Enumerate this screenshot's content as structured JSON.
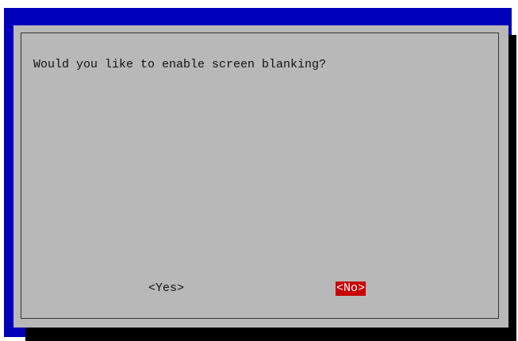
{
  "dialog": {
    "question": "Would you like to enable screen blanking?",
    "buttons": {
      "yes_label": "<Yes>",
      "no_label": "<No>"
    },
    "selected_button": "No"
  },
  "colors": {
    "background": "#0000bb",
    "dialog": "#b8b8b8",
    "shadow": "#000000",
    "selected_button": "#c80000",
    "selected_text": "#ffffff",
    "text": "#111111"
  }
}
